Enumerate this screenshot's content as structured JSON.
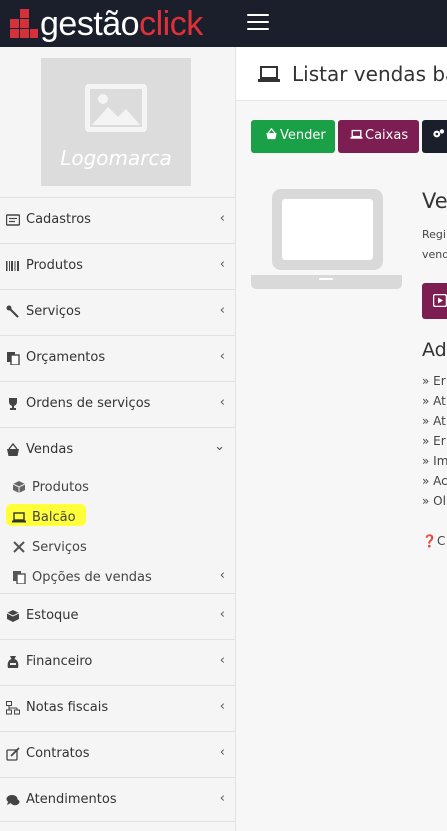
{
  "brand": {
    "name_part1": "gestão",
    "name_part2": "click",
    "accent": "#e0303a"
  },
  "company_logo": {
    "label": "Logomarca"
  },
  "sidebar": {
    "items": [
      {
        "label": "Cadastros",
        "icon": "id-card-icon"
      },
      {
        "label": "Produtos",
        "icon": "barcode-icon"
      },
      {
        "label": "Serviços",
        "icon": "wrench-icon"
      },
      {
        "label": "Orçamentos",
        "icon": "copy-icon"
      },
      {
        "label": "Ordens de serviços",
        "icon": "trophy-icon"
      },
      {
        "label": "Vendas",
        "icon": "basket-icon",
        "expanded": true
      },
      {
        "label": "Estoque",
        "icon": "cube-icon"
      },
      {
        "label": "Financeiro",
        "icon": "money-bag-icon"
      },
      {
        "label": "Notas fiscais",
        "icon": "sitemap-icon"
      },
      {
        "label": "Contratos",
        "icon": "edit-icon"
      },
      {
        "label": "Atendimentos",
        "icon": "comments-icon"
      }
    ],
    "vendas_sub": [
      {
        "label": "Produtos",
        "icon": "cube-icon"
      },
      {
        "label": "Balcão",
        "icon": "laptop-icon",
        "highlighted": true
      },
      {
        "label": "Serviços",
        "icon": "tools-icon"
      },
      {
        "label": "Opções de vendas",
        "icon": "copy-icon"
      }
    ]
  },
  "page": {
    "title": "Listar vendas ba"
  },
  "toolbar": {
    "vender_label": "Vender",
    "caixas_label": "Caixas"
  },
  "info": {
    "title": "Ve",
    "text_line1": "Regi",
    "text_line2": "vend",
    "additional_title": "Adi",
    "bullets": [
      "Er",
      "At",
      "At",
      "Er",
      "Im",
      "Ac",
      "Ol"
    ],
    "help": "C"
  },
  "colors": {
    "green": "#1aa046",
    "wine": "#7d1e52",
    "dark": "#1a1f2b",
    "highlight": "#ffff3a"
  }
}
